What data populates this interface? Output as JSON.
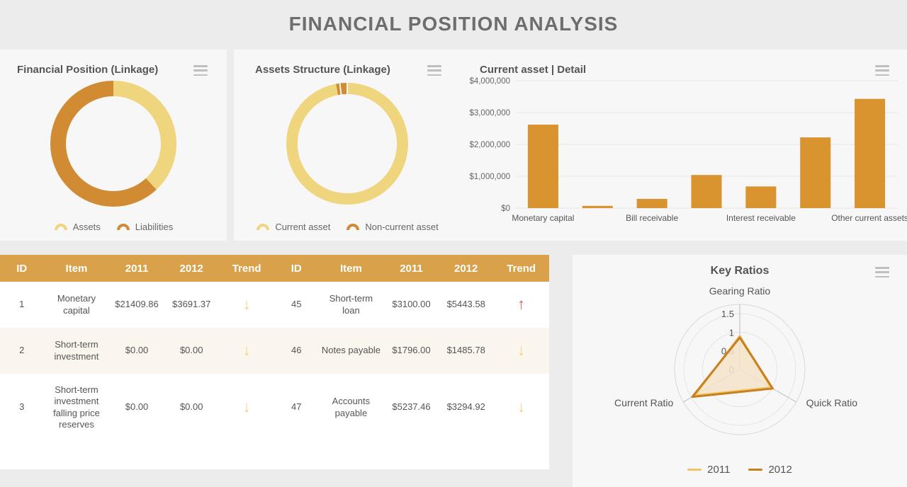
{
  "header": {
    "title": "FINANCIAL POSITION ANALYSIS"
  },
  "colors": {
    "light_gold": "#EFD57E",
    "dark_orange": "#D08B33",
    "bar_orange": "#D9932F",
    "header_gold": "#D9A24A",
    "arrow_down": "#F2D27A",
    "arrow_up": "#DC5B55",
    "radar_2011": "#EFC667",
    "radar_2012": "#C8801E",
    "radar_fill": "#F3E3C8",
    "panel_bg": "#F7F7F7",
    "page_bg": "#ECECEC",
    "title_text": "#6E6E6E"
  },
  "panels": {
    "financial_position": {
      "title": "Financial Position (Linkage)",
      "menu_icon": "hamburger-icon"
    },
    "assets_structure": {
      "title": "Assets Structure (Linkage)",
      "menu_icon": "hamburger-icon"
    },
    "current_asset": {
      "title": "Current asset | Detail",
      "menu_icon": "hamburger-icon"
    },
    "key_ratios": {
      "title": "Key Ratios",
      "menu_icon": "hamburger-icon"
    }
  },
  "chart_data": [
    {
      "id": "financial_position_donut",
      "type": "pie",
      "title": "Financial Position (Linkage)",
      "legend_position": "bottom",
      "labels": [
        "Assets",
        "Liabilities"
      ],
      "values": [
        38,
        62
      ],
      "colors": [
        "#EFD57E",
        "#D08B33"
      ]
    },
    {
      "id": "assets_structure_donut",
      "type": "pie",
      "title": "Assets Structure (Linkage)",
      "legend_position": "bottom",
      "labels": [
        "Current asset",
        "Non-current asset"
      ],
      "values": [
        97,
        3
      ],
      "colors": [
        "#EFD57E",
        "#D08B33"
      ]
    },
    {
      "id": "current_asset_detail_bar",
      "type": "bar",
      "title": "Current asset | Detail",
      "xlabel": "",
      "ylabel": "",
      "ylim": [
        0,
        4000000
      ],
      "grid": true,
      "ytick_labels": [
        "$0",
        "$1,000,000",
        "$2,000,000",
        "$3,000,000",
        "$4,000,000"
      ],
      "ytick_values": [
        0,
        1000000,
        2000000,
        3000000,
        4000000
      ],
      "categories": [
        "Monetary capital",
        "",
        "Bill receivable",
        "",
        "Interest receivable",
        "",
        "Other current assets"
      ],
      "visible_tick_labels": [
        "Monetary capital",
        "Bill receivable",
        "Interest receivable",
        "Other current assets"
      ],
      "values": [
        2620000,
        70000,
        290000,
        1040000,
        680000,
        2220000,
        3430000
      ],
      "color": "#D9932F"
    },
    {
      "id": "key_ratios_radar",
      "type": "line",
      "subtype": "radar",
      "title": "Key Ratios",
      "legend_position": "bottom",
      "axes": [
        "Gearing Ratio",
        "Quick Ratio",
        "Current Ratio"
      ],
      "rings": [
        0,
        0.5,
        1,
        1.5
      ],
      "ring_labels": [
        "0",
        "0.5",
        "1",
        "1.5"
      ],
      "rmax": 1.75,
      "series": [
        {
          "name": "2011",
          "values": [
            0.9,
            0.97,
            1.4
          ],
          "color": "#EFC667"
        },
        {
          "name": "2012",
          "values": [
            0.86,
            1.02,
            1.47
          ],
          "color": "#C8801E"
        }
      ]
    }
  ],
  "table": {
    "columns": [
      "ID",
      "Item",
      "2011",
      "2012",
      "Trend",
      "ID",
      "Item",
      "2011",
      "2012",
      "Trend"
    ],
    "rows": [
      {
        "left": {
          "id": "1",
          "item": "Monetary capital",
          "y2011": "$21409.86",
          "y2012": "$3691.37",
          "trend": "down"
        },
        "right": {
          "id": "45",
          "item": "Short-term loan",
          "y2011": "$3100.00",
          "y2012": "$5443.58",
          "trend": "up"
        }
      },
      {
        "left": {
          "id": "2",
          "item": "Short-term investment",
          "y2011": "$0.00",
          "y2012": "$0.00",
          "trend": "down"
        },
        "right": {
          "id": "46",
          "item": "Notes payable",
          "y2011": "$1796.00",
          "y2012": "$1485.78",
          "trend": "down"
        }
      },
      {
        "left": {
          "id": "3",
          "item": "Short-term investment falling price reserves",
          "y2011": "$0.00",
          "y2012": "$0.00",
          "trend": "down"
        },
        "right": {
          "id": "47",
          "item": "Accounts payable",
          "y2011": "$5237.46",
          "y2012": "$3294.92",
          "trend": "down"
        }
      }
    ],
    "trend_glyphs": {
      "up": "↑",
      "down": "↓"
    }
  }
}
